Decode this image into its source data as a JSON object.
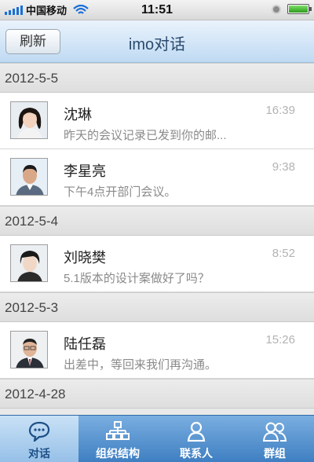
{
  "status_bar": {
    "carrier": "中国移动",
    "time": "11:51"
  },
  "nav": {
    "refresh_label": "刷新",
    "title": "imo对话"
  },
  "groups": [
    {
      "date": "2012-5-5",
      "items": [
        {
          "name": "沈琳",
          "preview": "昨天的会议记录已发到你的邮...",
          "time": "16:39",
          "avatar": "avatar-woman"
        },
        {
          "name": "李星亮",
          "preview": "下午4点开部门会议。",
          "time": "9:38",
          "avatar": "avatar-man"
        }
      ]
    },
    {
      "date": "2012-5-4",
      "items": [
        {
          "name": "刘晓樊",
          "preview": "5.1版本的设计案做好了吗？",
          "time": "8:52",
          "avatar": "avatar-woman-2"
        }
      ]
    },
    {
      "date": "2012-5-3",
      "items": [
        {
          "name": "陆任磊",
          "preview": "出差中，等回来我们再沟通。",
          "time": "15:26",
          "avatar": "avatar-man-2"
        }
      ]
    },
    {
      "date": "2012-4-28",
      "items": []
    }
  ],
  "tabs": [
    {
      "label": "对话",
      "icon": "chat-bubble-icon",
      "active": true
    },
    {
      "label": "组织结构",
      "icon": "org-chart-icon",
      "active": false
    },
    {
      "label": "联系人",
      "icon": "person-icon",
      "active": false
    },
    {
      "label": "群组",
      "icon": "group-icon",
      "active": false
    }
  ]
}
